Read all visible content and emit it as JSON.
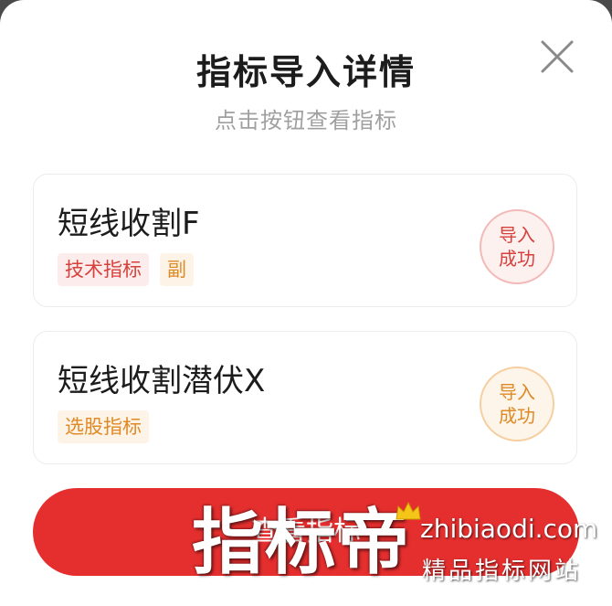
{
  "modal": {
    "title": "指标导入详情",
    "subtitle": "点击按钮查看指标",
    "close_icon": "close-icon"
  },
  "items": [
    {
      "name": "短线收割F",
      "tags": [
        "技术指标",
        "副"
      ],
      "stamp": [
        "导入",
        "成功"
      ],
      "stamp_color": "#d6413c"
    },
    {
      "name": "短线收割潜伏X",
      "tags": [
        "选股指标"
      ],
      "stamp": [
        "导入",
        "成功"
      ],
      "stamp_color": "#e08a26"
    }
  ],
  "button": {
    "label": "查看指标",
    "color": "#e52e2e"
  },
  "watermark": {
    "main": "指标帝",
    "url": "zhibiaodi.com",
    "sub": "精品指标网站"
  }
}
